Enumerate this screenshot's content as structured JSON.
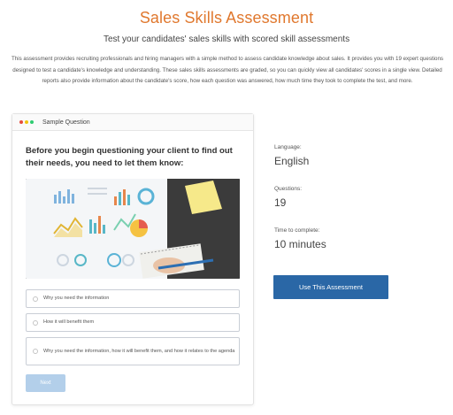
{
  "header": {
    "title": "Sales Skills Assessment",
    "subtitle": "Test your candidates' sales skills with scored skill assessments",
    "description": "This assessment provides recruiting professionals and hiring managers with a simple method to assess candidate knowledge about sales. It provides you with 19 expert questions designed to test a candidate's knowledge and understanding. These sales skills assessments are graded, so you can quickly view all candidates' scores in a single view. Detailed reports also provide information about the candidate's score, how each question was answered, how much time they took to complete the test, and more."
  },
  "sample": {
    "header_label": "Sample Question",
    "dot_colors": [
      "#e74c3c",
      "#f1c40f",
      "#2ecc71"
    ],
    "question": "Before you begin questioning your client to find out their needs, you need to let them know:",
    "image_icon": "business-report-photo",
    "options": [
      "Why you need the information",
      "How it will benefit them",
      "Why you need the information, how it will benefit them, and how it relates to the agenda"
    ],
    "next_label": "Next"
  },
  "details": {
    "language_label": "Language:",
    "language_value": "English",
    "questions_label": "Questions:",
    "questions_value": "19",
    "time_label": "Time to complete:",
    "time_value": "10 minutes"
  },
  "cta": {
    "label": "Use This Assessment",
    "color": "#2a67a6"
  },
  "colors": {
    "title": "#e0782e",
    "next_button": "#b3cfea"
  }
}
